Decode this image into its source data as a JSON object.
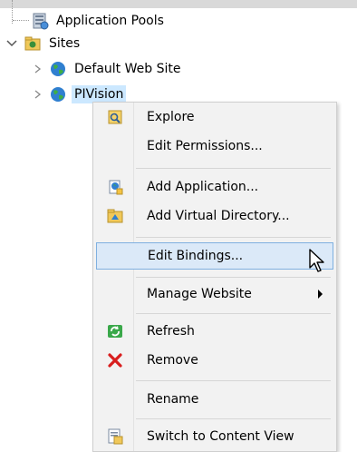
{
  "tree": {
    "items": [
      {
        "label": "Application Pools"
      },
      {
        "label": "Sites"
      },
      {
        "label": "Default Web Site"
      },
      {
        "label": "PIVision"
      }
    ]
  },
  "context_menu": {
    "items": [
      {
        "label": "Explore",
        "icon": "explore-icon"
      },
      {
        "label": "Edit Permissions..."
      },
      {
        "label": "Add Application...",
        "icon": "add-application-icon"
      },
      {
        "label": "Add Virtual Directory...",
        "icon": "add-virtual-directory-icon"
      },
      {
        "label": "Edit Bindings...",
        "state": "hovered"
      },
      {
        "label": "Manage Website",
        "submenu": true
      },
      {
        "label": "Refresh",
        "icon": "refresh-icon"
      },
      {
        "label": "Remove",
        "icon": "remove-icon"
      },
      {
        "label": "Rename"
      },
      {
        "label": "Switch to Content View",
        "icon": "content-view-icon"
      }
    ]
  },
  "colors": {
    "selection": "#cce8ff",
    "menu_background": "#f2f2f2",
    "hover_background": "#dbe9f8",
    "hover_border": "#7fb0e0",
    "remove_red": "#d81e1e"
  }
}
